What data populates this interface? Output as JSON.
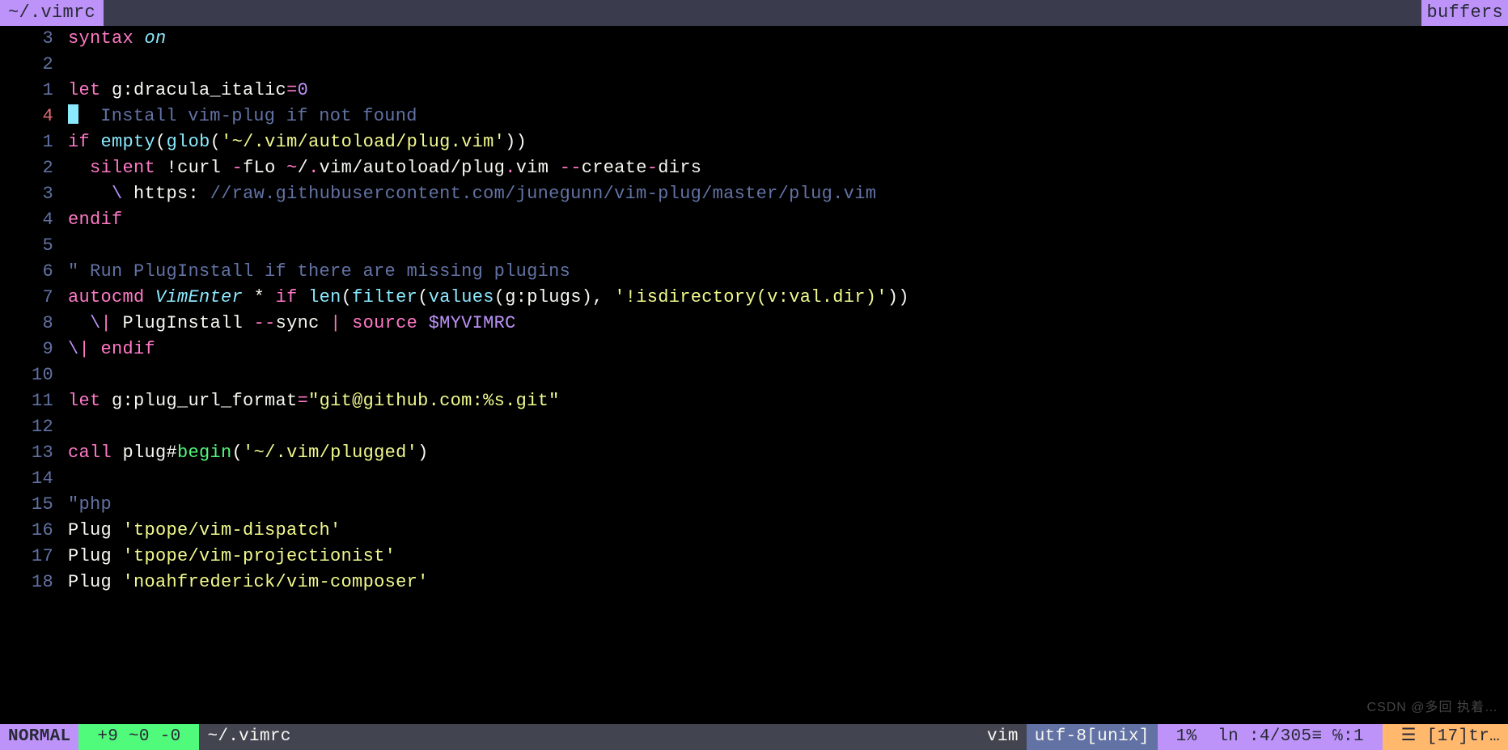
{
  "tabline": {
    "active_tab": "~/.vimrc",
    "right_label": "buffers"
  },
  "editor": {
    "cursor_line_index": 3,
    "lines": [
      {
        "num": "3",
        "tokens": [
          {
            "t": "syntax",
            "cls": "c-pink"
          },
          {
            "t": " ",
            "cls": "c-fg"
          },
          {
            "t": "on",
            "cls": "c-cyan ital"
          }
        ]
      },
      {
        "num": "2",
        "tokens": []
      },
      {
        "num": "1",
        "tokens": [
          {
            "t": "let",
            "cls": "c-pink"
          },
          {
            "t": " g:",
            "cls": "c-fg"
          },
          {
            "t": "dracula_italic",
            "cls": "c-fg"
          },
          {
            "t": "=",
            "cls": "c-pink"
          },
          {
            "t": "0",
            "cls": "c-purple"
          }
        ]
      },
      {
        "num": "4",
        "current": true,
        "tokens": [
          {
            "t": "",
            "cls": "",
            "cursor": true
          },
          {
            "t": "  Install vim-plug if not found",
            "cls": "c-comment"
          }
        ]
      },
      {
        "num": "1",
        "tokens": [
          {
            "t": "if",
            "cls": "c-pink"
          },
          {
            "t": " ",
            "cls": "c-fg"
          },
          {
            "t": "empty",
            "cls": "c-cyan"
          },
          {
            "t": "(",
            "cls": "c-fg"
          },
          {
            "t": "glob",
            "cls": "c-cyan"
          },
          {
            "t": "(",
            "cls": "c-fg"
          },
          {
            "t": "'~/.vim/autoload/plug.vim'",
            "cls": "c-yellow"
          },
          {
            "t": "))",
            "cls": "c-fg"
          }
        ]
      },
      {
        "num": "2",
        "tokens": [
          {
            "t": "  ",
            "cls": "c-fg"
          },
          {
            "t": "silent",
            "cls": "c-pink"
          },
          {
            "t": " ",
            "cls": "c-fg"
          },
          {
            "t": "!",
            "cls": "c-fg"
          },
          {
            "t": "curl ",
            "cls": "c-fg"
          },
          {
            "t": "-",
            "cls": "c-pink"
          },
          {
            "t": "fLo ",
            "cls": "c-fg"
          },
          {
            "t": "~",
            "cls": "c-pink"
          },
          {
            "t": "/",
            "cls": "c-fg"
          },
          {
            "t": ".",
            "cls": "c-pink"
          },
          {
            "t": "vim/autoload/plug",
            "cls": "c-fg"
          },
          {
            "t": ".",
            "cls": "c-pink"
          },
          {
            "t": "vim ",
            "cls": "c-fg"
          },
          {
            "t": "--",
            "cls": "c-pink"
          },
          {
            "t": "create",
            "cls": "c-fg"
          },
          {
            "t": "-",
            "cls": "c-pink"
          },
          {
            "t": "dirs",
            "cls": "c-fg"
          }
        ]
      },
      {
        "num": "3",
        "tokens": [
          {
            "t": "    ",
            "cls": "c-fg"
          },
          {
            "t": "\\",
            "cls": "c-purple"
          },
          {
            "t": " https:",
            "cls": "c-fg"
          },
          {
            "t": " ",
            "cls": "c-fg"
          },
          {
            "t": "//raw.githubusercontent.com/junegunn/vim-plug/master/plug.vim",
            "cls": "c-comment"
          }
        ]
      },
      {
        "num": "4",
        "tokens": [
          {
            "t": "endif",
            "cls": "c-pink"
          }
        ]
      },
      {
        "num": "5",
        "tokens": []
      },
      {
        "num": "6",
        "tokens": [
          {
            "t": "\" Run PlugInstall if there are missing plugins",
            "cls": "c-comment"
          }
        ]
      },
      {
        "num": "7",
        "tokens": [
          {
            "t": "autocmd",
            "cls": "c-pink"
          },
          {
            "t": " ",
            "cls": "c-fg"
          },
          {
            "t": "VimEnter",
            "cls": "c-cyan ital"
          },
          {
            "t": " ",
            "cls": "c-fg"
          },
          {
            "t": "*",
            "cls": "c-fg"
          },
          {
            "t": " ",
            "cls": "c-fg"
          },
          {
            "t": "if",
            "cls": "c-pink"
          },
          {
            "t": " ",
            "cls": "c-fg"
          },
          {
            "t": "len",
            "cls": "c-cyan"
          },
          {
            "t": "(",
            "cls": "c-fg"
          },
          {
            "t": "filter",
            "cls": "c-cyan"
          },
          {
            "t": "(",
            "cls": "c-fg"
          },
          {
            "t": "values",
            "cls": "c-cyan"
          },
          {
            "t": "(g:plugs), ",
            "cls": "c-fg"
          },
          {
            "t": "'!isdirectory(v:val.dir)'",
            "cls": "c-yellow"
          },
          {
            "t": "))",
            "cls": "c-fg"
          }
        ]
      },
      {
        "num": "8",
        "tokens": [
          {
            "t": "  ",
            "cls": "c-fg"
          },
          {
            "t": "\\",
            "cls": "c-purple"
          },
          {
            "t": "|",
            "cls": "c-pink"
          },
          {
            "t": " PlugInstall ",
            "cls": "c-fg"
          },
          {
            "t": "--",
            "cls": "c-pink"
          },
          {
            "t": "sync ",
            "cls": "c-fg"
          },
          {
            "t": "|",
            "cls": "c-pink"
          },
          {
            "t": " ",
            "cls": "c-fg"
          },
          {
            "t": "source",
            "cls": "c-pink"
          },
          {
            "t": " ",
            "cls": "c-fg"
          },
          {
            "t": "$MYVIMRC",
            "cls": "c-purple"
          }
        ]
      },
      {
        "num": "9",
        "tokens": [
          {
            "t": "\\",
            "cls": "c-purple"
          },
          {
            "t": "|",
            "cls": "c-pink"
          },
          {
            "t": " ",
            "cls": "c-fg"
          },
          {
            "t": "endif",
            "cls": "c-pink"
          }
        ]
      },
      {
        "num": "10",
        "tokens": []
      },
      {
        "num": "11",
        "tokens": [
          {
            "t": "let",
            "cls": "c-pink"
          },
          {
            "t": " g:plug_url_format",
            "cls": "c-fg"
          },
          {
            "t": "=",
            "cls": "c-pink"
          },
          {
            "t": "\"git@github.com:%s.git\"",
            "cls": "c-yellow"
          }
        ]
      },
      {
        "num": "12",
        "tokens": []
      },
      {
        "num": "13",
        "tokens": [
          {
            "t": "call",
            "cls": "c-pink"
          },
          {
            "t": " plug#",
            "cls": "c-fg"
          },
          {
            "t": "begin",
            "cls": "c-green"
          },
          {
            "t": "(",
            "cls": "c-fg"
          },
          {
            "t": "'~/.vim/plugged'",
            "cls": "c-yellow"
          },
          {
            "t": ")",
            "cls": "c-fg"
          }
        ]
      },
      {
        "num": "14",
        "tokens": []
      },
      {
        "num": "15",
        "tokens": [
          {
            "t": "\"php",
            "cls": "c-comment"
          }
        ]
      },
      {
        "num": "16",
        "tokens": [
          {
            "t": "Plug ",
            "cls": "c-fg"
          },
          {
            "t": "'tpope/vim-dispatch'",
            "cls": "c-yellow"
          }
        ]
      },
      {
        "num": "17",
        "tokens": [
          {
            "t": "Plug ",
            "cls": "c-fg"
          },
          {
            "t": "'tpope/vim-projectionist'",
            "cls": "c-yellow"
          }
        ]
      },
      {
        "num": "18",
        "tokens": [
          {
            "t": "Plug ",
            "cls": "c-fg"
          },
          {
            "t": "'noahfrederick/vim-composer'",
            "cls": "c-yellow"
          }
        ]
      }
    ]
  },
  "statusline": {
    "mode": "NORMAL",
    "git": " +9 ~0 -0 ",
    "file": "~/.vimrc",
    "filetype": "vim",
    "encoding": "utf-8[unix]",
    "position": " 1%  ln :4/305≡ ℅:1 ",
    "diagnostics": " ☰ [17]tr…"
  },
  "watermark": "CSDN @多回 执着…"
}
